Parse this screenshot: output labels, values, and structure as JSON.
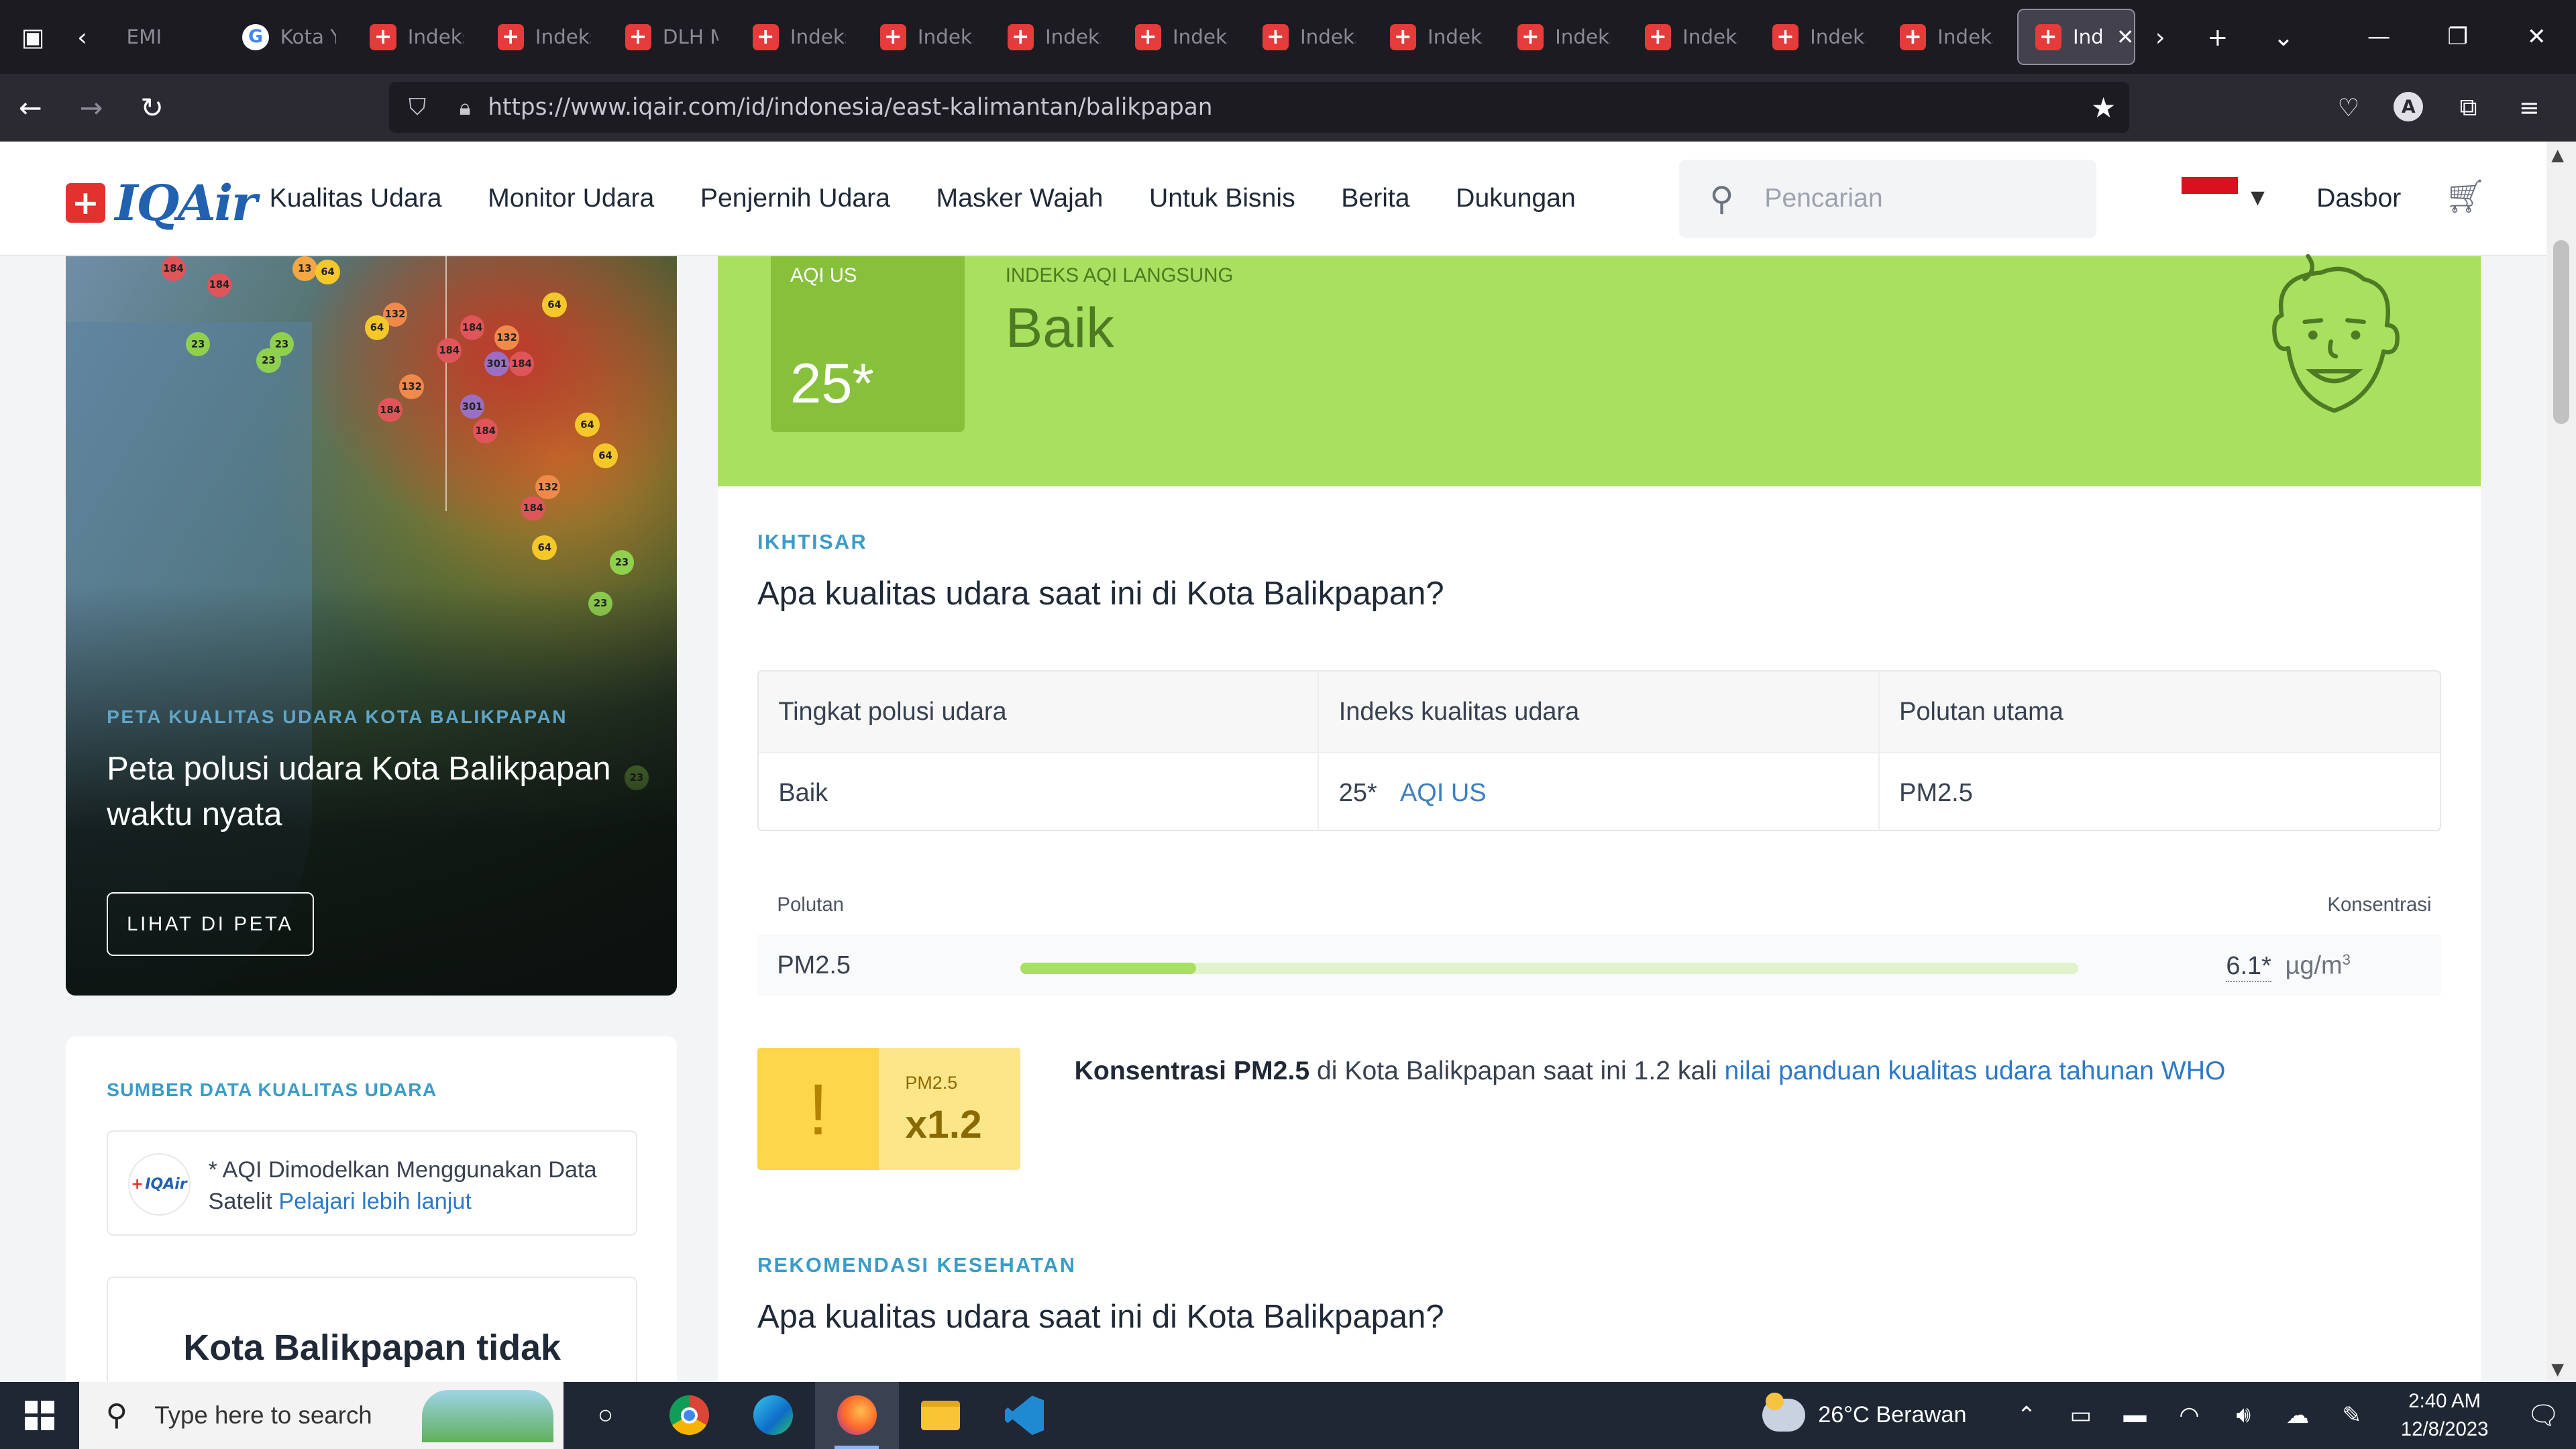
{
  "browser": {
    "tabs": [
      {
        "label": "EMI",
        "favicon": "none"
      },
      {
        "label": "Kota Y",
        "favicon": "google"
      },
      {
        "label": "Indeks",
        "favicon": "iqair"
      },
      {
        "label": "Indeks",
        "favicon": "iqair"
      },
      {
        "label": "DLH M",
        "favicon": "iqair"
      },
      {
        "label": "Indeks",
        "favicon": "iqair"
      },
      {
        "label": "Indeks",
        "favicon": "iqair"
      },
      {
        "label": "Indeks",
        "favicon": "iqair"
      },
      {
        "label": "Indeks",
        "favicon": "iqair"
      },
      {
        "label": "Indeks",
        "favicon": "iqair"
      },
      {
        "label": "Indeks",
        "favicon": "iqair"
      },
      {
        "label": "Indeks",
        "favicon": "iqair"
      },
      {
        "label": "Indeks",
        "favicon": "iqair"
      },
      {
        "label": "Indeks",
        "favicon": "iqair"
      },
      {
        "label": "Indeks",
        "favicon": "iqair"
      }
    ],
    "active_tab": {
      "label": "Ind",
      "favicon": "iqair"
    },
    "url": "https://www.iqair.com/id/indonesia/east-kalimantan/balikpapan",
    "profile_initial": "A"
  },
  "site": {
    "logo_text": "IQAir",
    "nav": [
      "Kualitas Udara",
      "Monitor Udara",
      "Penjernih Udara",
      "Masker Wajah",
      "Untuk Bisnis",
      "Berita",
      "Dukungan"
    ],
    "search_placeholder": "Pencarian",
    "dashboard_label": "Dasbor",
    "flag_colors": {
      "top": "#d9101e",
      "bottom": "#ffffff"
    }
  },
  "map_card": {
    "eyebrow": "PETA KUALITAS UDARA KOTA BALIKPAPAN",
    "title": "Peta polusi udara Kota Balikpapan waktu nyata",
    "button": "LIHAT DI PETA",
    "markers": [
      {
        "v": "184",
        "c": "#e05559"
      },
      {
        "v": "13",
        "c": "#f4a742"
      },
      {
        "v": "64",
        "c": "#f5c82a"
      },
      {
        "v": "184",
        "c": "#e05559"
      },
      {
        "v": "132",
        "c": "#f08a4b"
      },
      {
        "v": "64",
        "c": "#f5c82a"
      },
      {
        "v": "184",
        "c": "#e05559"
      },
      {
        "v": "132",
        "c": "#f08a4b"
      },
      {
        "v": "64",
        "c": "#f5c82a"
      },
      {
        "v": "184",
        "c": "#e05559"
      },
      {
        "v": "301",
        "c": "#9b6fc3"
      },
      {
        "v": "184",
        "c": "#e05559"
      },
      {
        "v": "23",
        "c": "#8fd14f"
      },
      {
        "v": "23",
        "c": "#8fd14f"
      },
      {
        "v": "23",
        "c": "#8fd14f"
      },
      {
        "v": "132",
        "c": "#f08a4b"
      },
      {
        "v": "184",
        "c": "#e05559"
      },
      {
        "v": "301",
        "c": "#9b6fc3"
      },
      {
        "v": "184",
        "c": "#e05559"
      },
      {
        "v": "64",
        "c": "#f5c82a"
      },
      {
        "v": "64",
        "c": "#f5c82a"
      },
      {
        "v": "132",
        "c": "#f08a4b"
      },
      {
        "v": "184",
        "c": "#e05559"
      },
      {
        "v": "64",
        "c": "#f5c82a"
      },
      {
        "v": "23",
        "c": "#8fd14f"
      },
      {
        "v": "23",
        "c": "#8fd14f"
      },
      {
        "v": "23",
        "c": "#8fd14f"
      }
    ]
  },
  "source_card": {
    "eyebrow": "SUMBER DATA KUALITAS UDARA",
    "text": "* AQI Dimodelkan Menggunakan Data Satelit",
    "link": "Pelajari lebih lanjut",
    "not_listed": "Kota Balikpapan tidak"
  },
  "aqi_hero": {
    "label": "AQI US",
    "value": "25*",
    "live_label": "INDEKS AQI LANGSUNG",
    "status": "Baik",
    "bg": "#a8e05f",
    "box_bg": "#87c13c"
  },
  "overview": {
    "eyebrow": "IKHTISAR",
    "title": "Apa kualitas udara saat ini di Kota Balikpapan?",
    "headers": [
      "Tingkat polusi udara",
      "Indeks kualitas udara",
      "Polutan utama"
    ],
    "level": "Baik",
    "aqi_value": "25*",
    "aqi_unit": "AQI US",
    "main_pollutant": "PM2.5"
  },
  "pollutant": {
    "header_left": "Polutan",
    "header_right": "Konsentrasi",
    "name": "PM2.5",
    "value": "6.1*",
    "unit": "µg/m",
    "unit_sup": "3",
    "bar_fraction": 0.166
  },
  "who": {
    "pollutant": "PM2.5",
    "multiplier": "x1.2",
    "bold": "Konsentrasi PM2.5",
    "text": " di Kota Balikpapan saat ini 1.2 kali ",
    "link": "nilai panduan kualitas udara tahunan WHO"
  },
  "health": {
    "eyebrow": "REKOMENDASI KESEHATAN",
    "title": "Apa kualitas udara saat ini di Kota Balikpapan?"
  },
  "taskbar": {
    "search_placeholder": "Type here to search",
    "weather": "26°C  Berawan",
    "weather_badge": "1",
    "time": "2:40 AM",
    "date": "12/8/2023"
  }
}
